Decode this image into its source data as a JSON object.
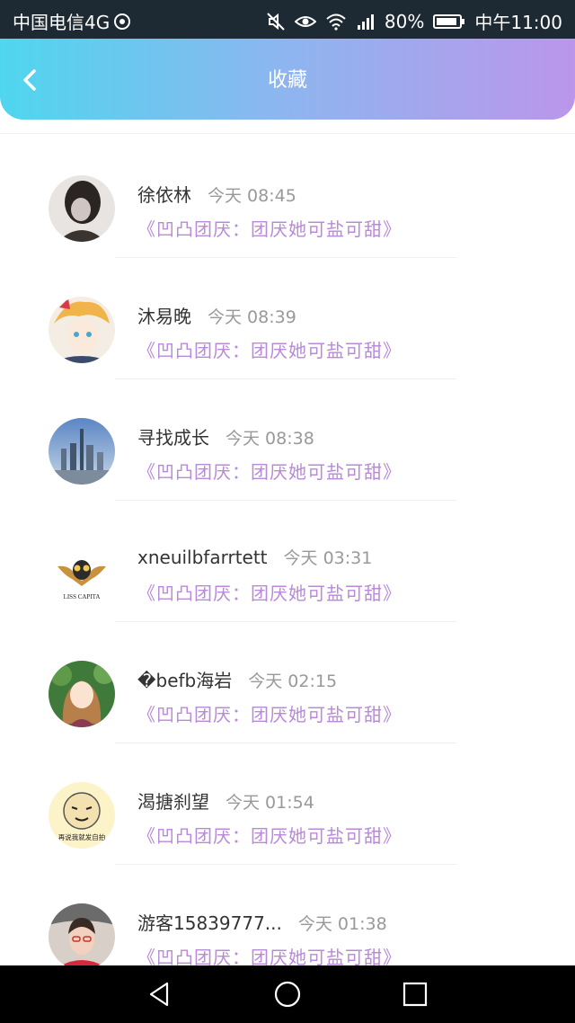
{
  "status_bar": {
    "carrier": "中国电信4G",
    "battery": "80%",
    "time": "中午11:00",
    "network": "4G"
  },
  "header": {
    "title": "收藏",
    "back_icon": "chevron-left-icon"
  },
  "favorites": [
    {
      "name": "徐依林",
      "time": "今天 08:45",
      "album": "《凹凸团厌：团厌她可盐可甜》"
    },
    {
      "name": "沐易晚",
      "time": "今天 08:39",
      "album": "《凹凸团厌：团厌她可盐可甜》"
    },
    {
      "name": "寻找成长",
      "time": "今天 08:38",
      "album": "《凹凸团厌：团厌她可盐可甜》"
    },
    {
      "name": "xneuilbfarrtett",
      "time": "今天 03:31",
      "album": "《凹凸团厌：团厌她可盐可甜》",
      "avatar_text": "LISS CAPITA"
    },
    {
      "name": "�befb海岩",
      "time": "今天 02:15",
      "album": "《凹凸团厌：团厌她可盐可甜》"
    },
    {
      "name": "渴搪刹望",
      "time": "今天 01:54",
      "album": "《凹凸团厌：团厌她可盐可甜》",
      "avatar_text": "再说我就发自拍"
    },
    {
      "name": "游客15839777...",
      "time": "今天 01:38",
      "album": "《凹凸团厌：团厌她可盐可甜》"
    }
  ],
  "colors": {
    "header_gradient_start": "#4fd6ef",
    "header_gradient_end": "#bb96ea",
    "album_link": "#b88ad9"
  }
}
